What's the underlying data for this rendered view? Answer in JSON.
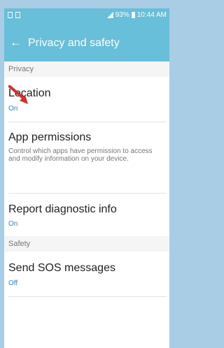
{
  "status_bar": {
    "battery": "93%",
    "time": "10:44 AM"
  },
  "app_bar": {
    "back_icon": "←",
    "title": "Privacy and safety"
  },
  "sections": {
    "privacy": {
      "header": "Privacy",
      "location": {
        "title": "Location",
        "value": "On"
      },
      "app_permissions": {
        "title": "App permissions",
        "description": "Control which apps have permission to access and modify information on your device."
      },
      "report": {
        "title": "Report diagnostic info",
        "value": "On"
      }
    },
    "safety": {
      "header": "Safety",
      "sos": {
        "title": "Send SOS messages",
        "value": "Off"
      }
    }
  },
  "colors": {
    "app_bar": "#67bfd9",
    "background": "#a9cde4",
    "value_text": "#2f87c8",
    "annotation_arrow": "#d3302b"
  }
}
